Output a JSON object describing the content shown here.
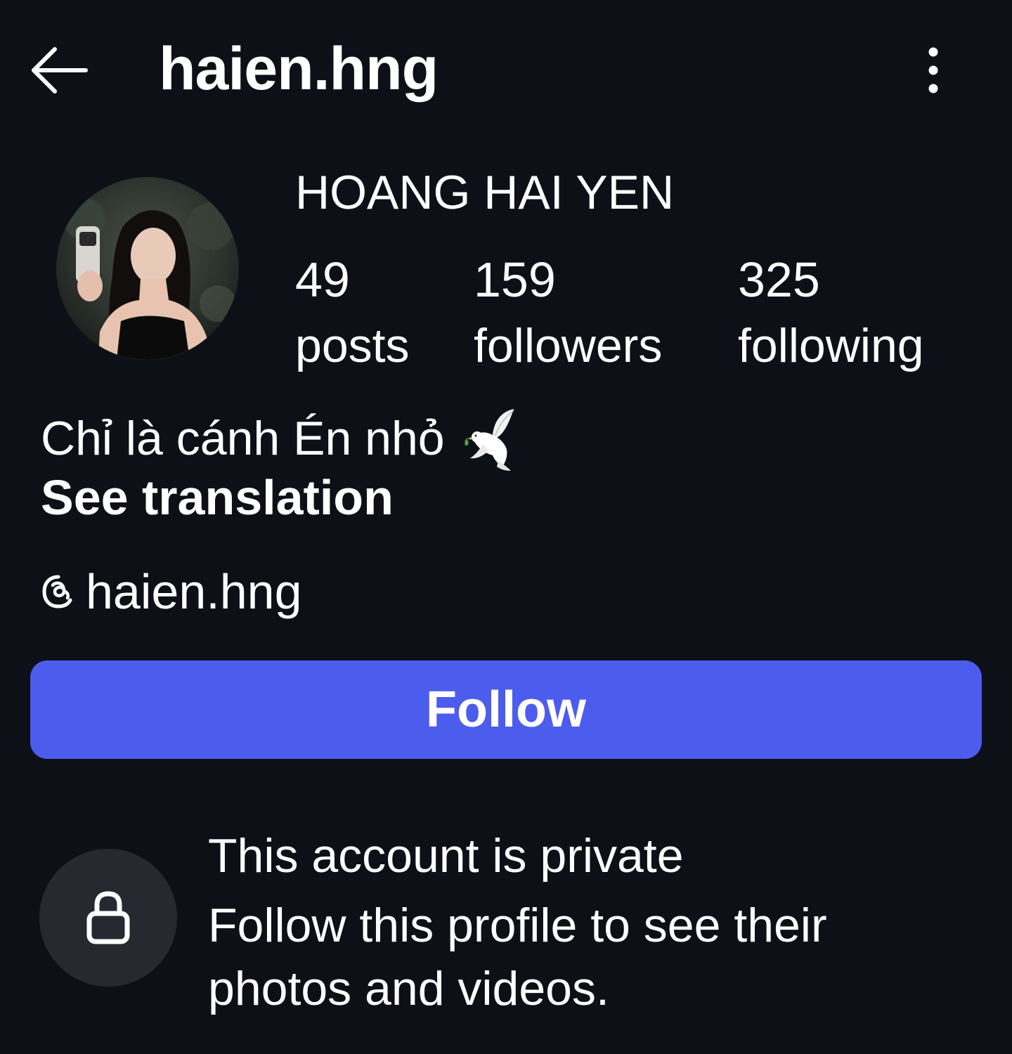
{
  "header": {
    "username": "haien.hng",
    "back_icon": "arrow-left-icon",
    "more_icon": "more-vertical-icon"
  },
  "profile": {
    "display_name": "HOANG HAI YEN",
    "avatar_icon": "profile-photo",
    "stats": {
      "posts": {
        "value": "49",
        "label": "posts"
      },
      "followers": {
        "value": "159",
        "label": "followers"
      },
      "following": {
        "value": "325",
        "label": "following"
      }
    },
    "bio": "Chỉ là cánh Én nhỏ",
    "bio_emoji_icon": "dove-icon",
    "see_translation": "See translation",
    "threads_icon": "threads-icon",
    "threads_handle": "haien.hng"
  },
  "actions": {
    "follow_label": "Follow",
    "accent_color": "#4c5ced"
  },
  "private_notice": {
    "icon": "lock-icon",
    "title": "This account is private",
    "description": "Follow this profile to see their photos and videos."
  },
  "colors": {
    "background": "#0d1117",
    "text": "#ffffff",
    "lock_circle": "#262a30"
  }
}
